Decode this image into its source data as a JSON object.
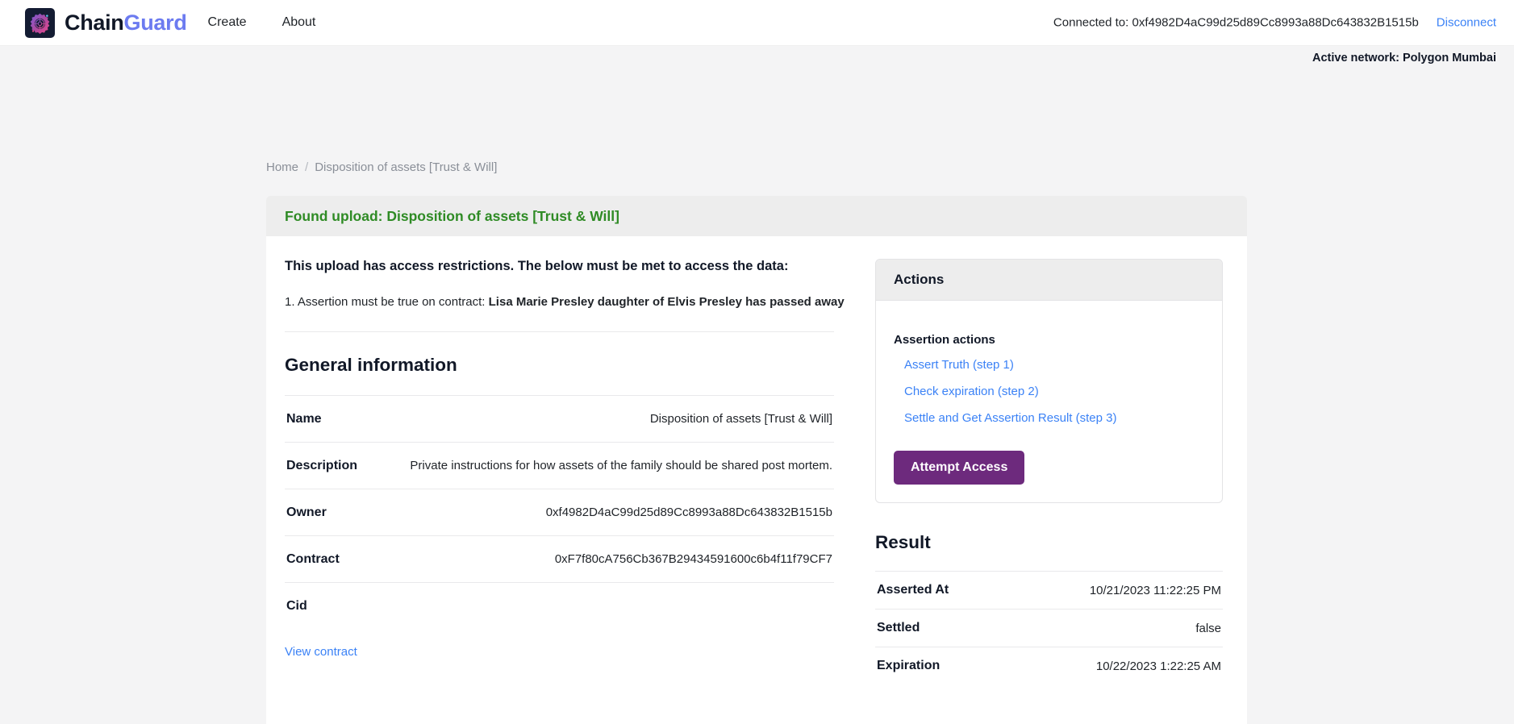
{
  "header": {
    "logo_icon": "gear-shield-logo-icon",
    "brand_first": "Chain",
    "brand_second": "Guard",
    "nav": [
      {
        "label": "Create"
      },
      {
        "label": "About"
      }
    ],
    "connected_text": "Connected to: 0xf4982D4aC99d25d89Cc8993a88Dc643832B1515b",
    "disconnect_label": "Disconnect",
    "active_network": "Active network: Polygon Mumbai"
  },
  "breadcrumb": {
    "home": "Home",
    "separator": "/",
    "current": "Disposition of assets [Trust & Will]"
  },
  "alert": {
    "text": "Found upload: Disposition of assets [Trust & Will]"
  },
  "restrictions": {
    "title": "This upload has access restrictions. The below must be met to access the data:",
    "item_prefix": "1. Assertion must be true on contract: ",
    "item_value": "Lisa Marie Presley daughter of Elvis Presley has passed away"
  },
  "general_information": {
    "title": "General information",
    "rows": [
      {
        "key": "Name",
        "value": "Disposition of assets [Trust & Will]"
      },
      {
        "key": "Description",
        "value": "Private instructions for how assets of the family should be shared post mortem."
      },
      {
        "key": "Owner",
        "value": "0xf4982D4aC99d25d89Cc8993a88Dc643832B1515b"
      },
      {
        "key": "Contract",
        "value": "0xF7f80cA756Cb367B29434591600c6b4f11f79CF7"
      },
      {
        "key": "Cid",
        "value": ""
      }
    ],
    "view_contract_label": "View contract"
  },
  "actions": {
    "panel_title": "Actions",
    "assertion_actions_title": "Assertion actions",
    "links": [
      {
        "label": "Assert Truth (step 1)"
      },
      {
        "label": "Check expiration (step 2)"
      },
      {
        "label": "Settle and Get Assertion Result (step 3)"
      }
    ],
    "attempt_access_label": "Attempt Access"
  },
  "result": {
    "title": "Result",
    "rows": [
      {
        "key": "Asserted At",
        "value": "10/21/2023 11:22:25 PM"
      },
      {
        "key": "Settled",
        "value": "false"
      },
      {
        "key": "Expiration",
        "value": "10/22/2023 1:22:25 AM"
      }
    ]
  },
  "colors": {
    "brand_accent": "#6c7bf0",
    "link": "#3b82f6",
    "success": "#2f8b25",
    "button_primary": "#6d2a7d",
    "page_bg": "#f4f4f5",
    "panel_head_bg": "#ededed"
  }
}
